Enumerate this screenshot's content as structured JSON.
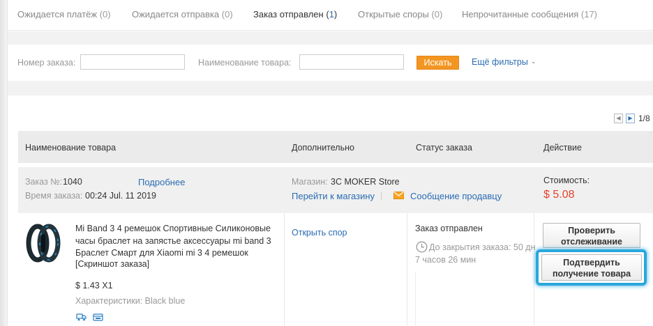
{
  "tabs": [
    {
      "label": "Ожидается платёж",
      "count": "(0)"
    },
    {
      "label": "Ожидается отправка",
      "count": "(0)"
    },
    {
      "label": "Заказ отправлен",
      "count_prefix": "(",
      "count_num": "1",
      "count_suffix": ")"
    },
    {
      "label": "Открытые споры",
      "count": "(0)"
    },
    {
      "label": "Непрочитанные сообщения",
      "count": "(17)"
    }
  ],
  "filters": {
    "order_number_label": "Номер заказа:",
    "order_number_value": "",
    "product_name_label": "Наименование товара:",
    "product_name_value": "",
    "search_button": "Искать",
    "more_filters": "Ещё фильтры",
    "more_filters_icon": "chevron-down-icon"
  },
  "pager": {
    "prev_icon": "triangle-left-icon",
    "next_icon": "triangle-right-icon",
    "info": "1/8"
  },
  "table_header": {
    "product": "Наименование товара",
    "extra": "Дополнительно",
    "status": "Статус заказа",
    "action": "Действие"
  },
  "order": {
    "order_label": "Заказ №:",
    "order_number": "1040",
    "details_link": "Подробнее",
    "time_label": "Время заказа:",
    "time_value": "00:24 Jul. 11 2019",
    "store_label": "Магазин:",
    "store_name": "3C MOKER Store",
    "go_to_store": "Перейти к магазину",
    "separator": "|",
    "message_seller": "Сообщение продавцу",
    "mail_icon": "envelope-icon",
    "cost_label": "Стоимость:",
    "cost_value": "$ 5.08"
  },
  "item": {
    "title": "Mi Band 3 4 ремешок Спортивные Силиконовые часы браслет на запястье аксессуары mi band 3 Браслет Смарт для Xiaomi mi 3 4 ремешок",
    "snapshot": "[Скриншот заказа]",
    "unit_price": "$ 1.43 X1",
    "props_label": "Характеристики:",
    "props_value": "Black blue",
    "open_dispute": "Открыть спор",
    "status": "Заказ отправлен",
    "countdown": "До закрытия заказа: 50 дн 7 часов 26 мин",
    "clock_icon": "clock-icon",
    "track_button": "Проверить отслеживание",
    "confirm_button": "Подтвердить получение товара",
    "colors": {
      "accent_link": "#2a6cb3",
      "price": "#e4432b",
      "search_button": "#f39621",
      "highlight": "#2aa7dc"
    }
  }
}
